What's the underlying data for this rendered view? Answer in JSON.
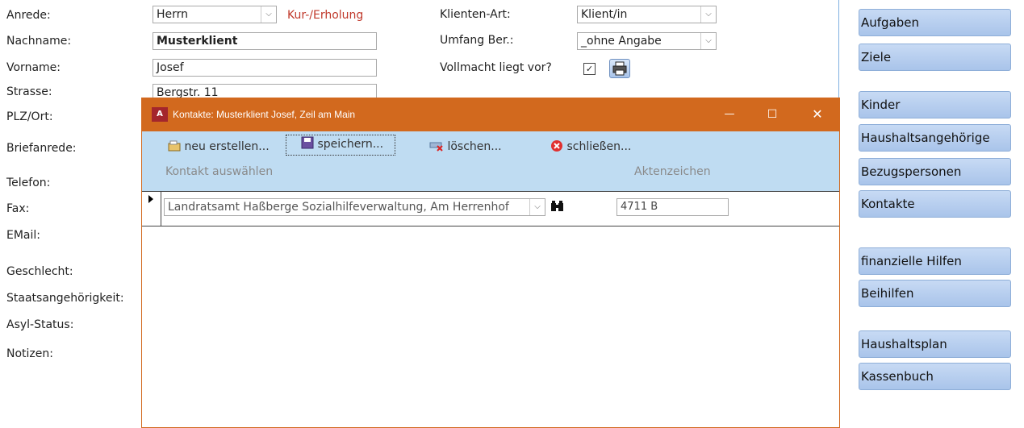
{
  "form": {
    "labels": {
      "anrede": "Anrede:",
      "nachname": "Nachname:",
      "vorname": "Vorname:",
      "strasse": "Strasse:",
      "plz_ort": "PLZ/Ort:",
      "briefanrede": "Briefanrede:",
      "telefon": "Telefon:",
      "fax": "Fax:",
      "email": "EMail:",
      "geschlecht": "Geschlecht:",
      "staatsangehoerigkeit": "Staatsangehörigkeit:",
      "asyl_status": "Asyl-Status:",
      "notizen": "Notizen:",
      "klienten_art": "Klienten-Art:",
      "umfang_ber": "Umfang Ber.:",
      "vollmacht": "Vollmacht liegt vor?"
    },
    "values": {
      "anrede": "Herrn",
      "nachname": "Musterklient",
      "vorname": "Josef",
      "strasse": "Bergstr. 11",
      "klienten_art": "Klient/in",
      "umfang_ber": "_ohne Angabe"
    },
    "kur_erholung": "Kur-/Erholung",
    "vollmacht_checked": true
  },
  "nav": {
    "buttons": [
      "Aufgaben",
      "Ziele",
      "Kinder",
      "Haushaltsangehörige",
      "Bezugspersonen",
      "Kontakte",
      "finanzielle Hilfen",
      "Beihilfen",
      "Haushaltsplan",
      "Kassenbuch"
    ]
  },
  "dialog": {
    "title": "Kontakte: Musterklient Josef, Zeil am Main",
    "app_icon": "A",
    "toolbar": {
      "neu": "neu erstellen...",
      "speichern": "speichern...",
      "loeschen": "löschen...",
      "schliessen": "schließen..."
    },
    "headers": {
      "kontakt": "Kontakt auswählen",
      "aktenzeichen": "Aktenzeichen"
    },
    "row": {
      "kontakt": "Landratsamt Haßberge Sozialhilfeverwaltung, Am Herrenhof",
      "aktenzeichen": "4711 B"
    },
    "window_buttons": {
      "minimize": "—",
      "maximize": "☐",
      "close": "✕"
    }
  },
  "colors": {
    "titlebar": "#d2691e",
    "toolbar": "#bfdcf2",
    "nav_button": "#b8cff0",
    "kur_text": "#c0392b"
  }
}
